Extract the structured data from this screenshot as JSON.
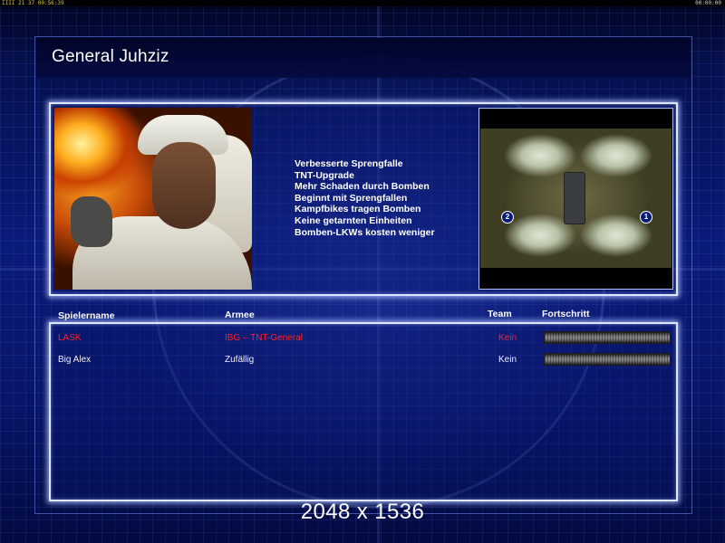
{
  "status_strip": {
    "left_text": "IIII 21 37 00:56:39",
    "right_text": "00:00:00"
  },
  "header": {
    "title": "General Juhziz"
  },
  "general": {
    "portrait": "general-portrait",
    "features": [
      "Verbesserte Sprengfalle",
      "TNT-Upgrade",
      "Mehr Schaden durch Bomben",
      "Beginnt mit Sprengfallen",
      "Kampfbikes tragen Bomben",
      "Keine getarnten Einheiten",
      "Bomben-LKWs kosten weniger"
    ]
  },
  "map": {
    "start_positions": [
      "2",
      "1"
    ]
  },
  "players_table": {
    "columns": {
      "name": "Spielername",
      "army": "Armee",
      "team": "Team",
      "progress": "Fortschritt"
    },
    "rows": [
      {
        "name": "LASK",
        "army": "IBG – TNT-General",
        "team": "Kein",
        "progress": 0,
        "color": "#ff2020"
      },
      {
        "name": "Big Alex",
        "army": "Zufällig",
        "team": "Kein",
        "progress": 0,
        "color": "#f0f0f0"
      }
    ]
  },
  "overlay": {
    "resolution": "2048 x 1536"
  },
  "colors": {
    "background": "#0a1a78",
    "panel_border": "#dfe6ff",
    "player_red": "#ff2020"
  }
}
